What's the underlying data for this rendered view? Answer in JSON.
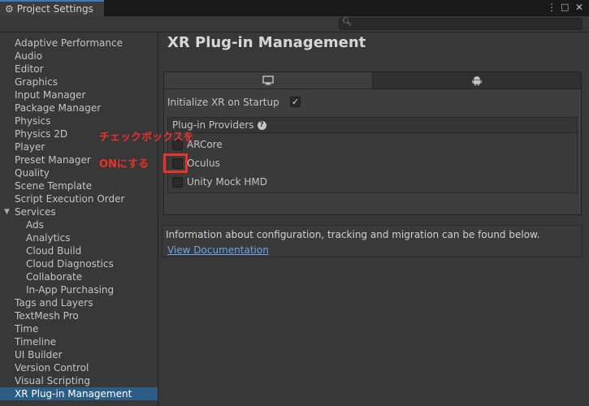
{
  "window": {
    "tab_label": "Project Settings",
    "menu_icon": "more-vertical-icon",
    "maximize_icon": "maximize-icon",
    "close_icon": "close-icon"
  },
  "search": {
    "placeholder": "",
    "icon": "search-icon"
  },
  "sidebar": {
    "items": [
      {
        "label": "Adaptive Performance"
      },
      {
        "label": "Audio"
      },
      {
        "label": "Editor"
      },
      {
        "label": "Graphics"
      },
      {
        "label": "Input Manager"
      },
      {
        "label": "Package Manager"
      },
      {
        "label": "Physics"
      },
      {
        "label": "Physics 2D"
      },
      {
        "label": "Player"
      },
      {
        "label": "Preset Manager"
      },
      {
        "label": "Quality"
      },
      {
        "label": "Scene Template"
      },
      {
        "label": "Script Execution Order"
      },
      {
        "label": "Services",
        "expanded": true
      },
      {
        "label": "Ads",
        "indent": 1
      },
      {
        "label": "Analytics",
        "indent": 1
      },
      {
        "label": "Cloud Build",
        "indent": 1
      },
      {
        "label": "Cloud Diagnostics",
        "indent": 1
      },
      {
        "label": "Collaborate",
        "indent": 1
      },
      {
        "label": "In-App Purchasing",
        "indent": 1
      },
      {
        "label": "Tags and Layers"
      },
      {
        "label": "TextMesh Pro"
      },
      {
        "label": "Time"
      },
      {
        "label": "Timeline"
      },
      {
        "label": "UI Builder"
      },
      {
        "label": "Version Control"
      },
      {
        "label": "Visual Scripting"
      },
      {
        "label": "XR Plug-in Management",
        "selected": true
      }
    ]
  },
  "main": {
    "title": "XR Plug-in Management",
    "platform_tabs": [
      {
        "icon": "desktop-monitor-icon",
        "active": true
      },
      {
        "icon": "android-icon",
        "active": false
      }
    ],
    "initialize_label": "Initialize XR on Startup",
    "initialize_checked": true,
    "providers_header": "Plug-in Providers",
    "providers": [
      {
        "label": "ARCore",
        "checked": false
      },
      {
        "label": "Oculus",
        "checked": false
      },
      {
        "label": "Unity Mock HMD",
        "checked": false
      }
    ],
    "info_text": "Information about configuration, tracking and migration can be found below.",
    "info_link": "View Documentation"
  },
  "annotation": {
    "line1": "チェックボックスを",
    "line2": "ONにする",
    "color": "#e8322a"
  }
}
